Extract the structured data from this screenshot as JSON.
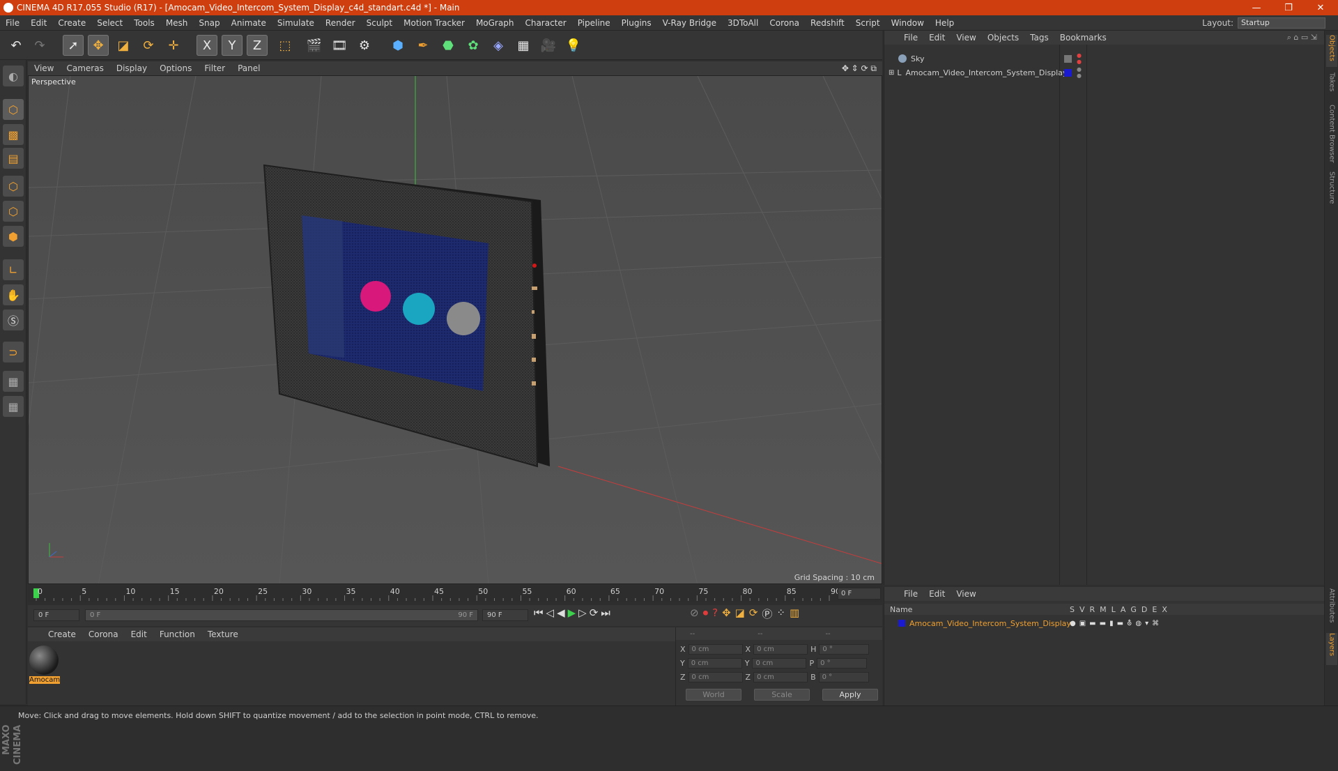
{
  "window": {
    "title": "CINEMA 4D R17.055 Studio (R17) - [Amocam_Video_Intercom_System_Display_c4d_standart.c4d *] - Main",
    "minimize": "—",
    "maximize": "❐",
    "close": "✕"
  },
  "menubar": {
    "items": [
      "File",
      "Edit",
      "Create",
      "Select",
      "Tools",
      "Mesh",
      "Snap",
      "Animate",
      "Simulate",
      "Render",
      "Sculpt",
      "Motion Tracker",
      "MoGraph",
      "Character",
      "Pipeline",
      "Plugins",
      "V-Ray Bridge",
      "3DToAll",
      "Corona",
      "Redshift",
      "Script",
      "Window",
      "Help"
    ],
    "layout_label": "Layout:",
    "layout_value": "Startup"
  },
  "toolbar": {
    "icons": [
      "undo-icon",
      "redo-icon",
      "select-icon",
      "move-icon",
      "scale-icon",
      "rotate-icon",
      "transform-icon",
      "x-axis-icon",
      "y-axis-icon",
      "z-axis-icon",
      "coord-system-icon",
      "render-view-icon",
      "render-picture-icon",
      "edit-render-settings-icon",
      "cube-icon",
      "pen-icon",
      "subdivision-icon",
      "array-icon",
      "deformer-icon",
      "floor-icon",
      "camera-icon",
      "light-icon"
    ],
    "x_label": "X",
    "y_label": "Y",
    "z_label": "Z"
  },
  "viewport": {
    "menu": [
      "View",
      "Cameras",
      "Display",
      "Options",
      "Filter",
      "Panel"
    ],
    "label": "Perspective",
    "grid_spacing": "Grid Spacing : 10 cm"
  },
  "timeline": {
    "ticks": [
      "0",
      "5",
      "10",
      "15",
      "20",
      "25",
      "30",
      "35",
      "40",
      "45",
      "50",
      "55",
      "60",
      "65",
      "70",
      "75",
      "80",
      "85",
      "90"
    ],
    "current_frame_field": "0 F",
    "start_field": "0 F",
    "range_start": "0 F",
    "range_end": "90 F",
    "end_field": "90 F"
  },
  "material_panel": {
    "menu": [
      "Create",
      "Corona",
      "Edit",
      "Function",
      "Texture"
    ],
    "material_name": "Amocam"
  },
  "coordinates": {
    "header": [
      "--",
      "--",
      "--"
    ],
    "rows": [
      {
        "l1": "X",
        "v1": "0 cm",
        "l2": "X",
        "v2": "0 cm",
        "l3": "H",
        "v3": "0 °"
      },
      {
        "l1": "Y",
        "v1": "0 cm",
        "l2": "Y",
        "v2": "0 cm",
        "l3": "P",
        "v3": "0 °"
      },
      {
        "l1": "Z",
        "v1": "0 cm",
        "l2": "Z",
        "v2": "0 cm",
        "l3": "B",
        "v3": "0 °"
      }
    ],
    "world": "World",
    "scale": "Scale",
    "apply": "Apply"
  },
  "object_manager": {
    "menu": [
      "File",
      "Edit",
      "View",
      "Objects",
      "Tags",
      "Bookmarks"
    ],
    "objects": [
      {
        "name": "Sky"
      },
      {
        "name": "Amocam_Video_Intercom_System_Display"
      }
    ]
  },
  "layer_manager": {
    "menu": [
      "File",
      "Edit",
      "View"
    ],
    "name_header": "Name",
    "columns": [
      "S",
      "V",
      "R",
      "M",
      "L",
      "A",
      "G",
      "D",
      "E",
      "X"
    ],
    "layer_name": "Amocam_Video_Intercom_System_Display"
  },
  "right_tabs": [
    "Objects",
    "Takes",
    "Content Browser",
    "Structure",
    "Attributes",
    "Layers"
  ],
  "maxon_logo": "MAXON CINEMA 4D",
  "status": "Move: Click and drag to move elements. Hold down SHIFT to quantize movement / add to the selection in point mode, CTRL to remove.",
  "colors": {
    "title_bar": "#cf3e0e",
    "accent": "#f0a030",
    "layer_color": "#1a1ad0"
  }
}
